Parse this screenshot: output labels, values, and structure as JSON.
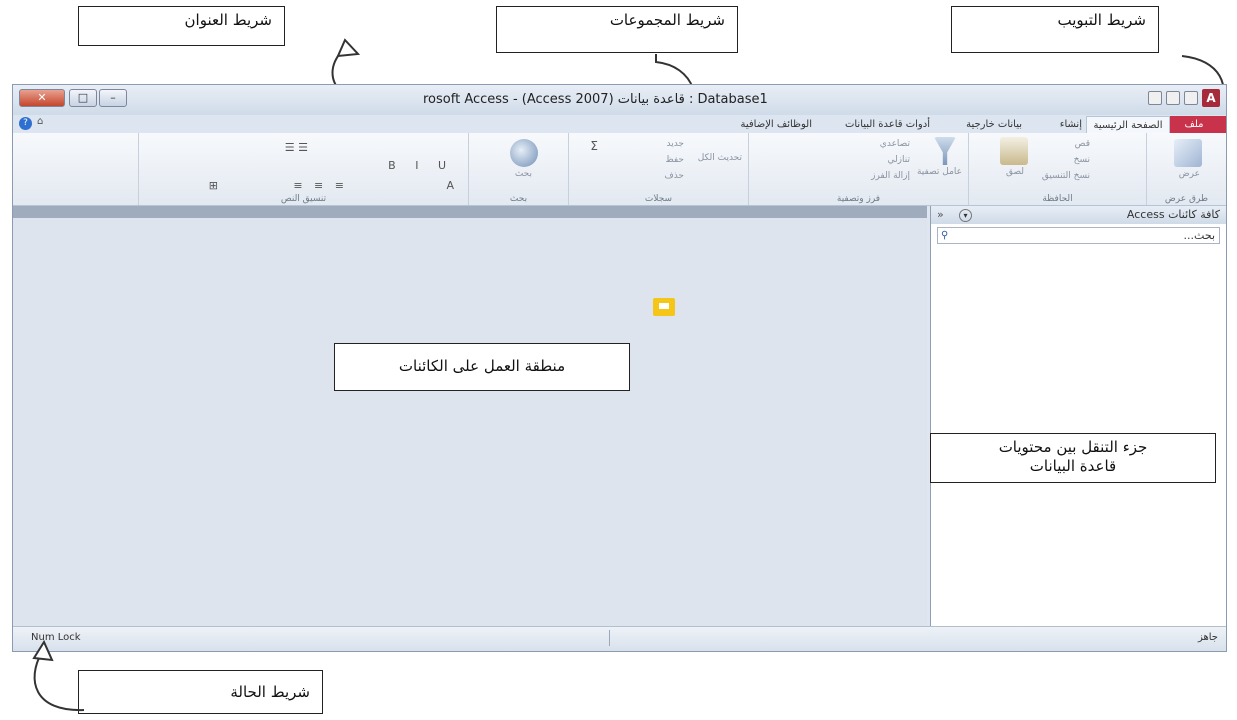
{
  "callouts": {
    "title_bar": "شريط العنوان",
    "groups_bar": "شريط المجموعات",
    "tabs_bar": "شريط التبويب",
    "object_workspace": "منطقة العمل على الكائنات",
    "nav_pane_line1": "جزء التنقل بين محتويات",
    "nav_pane_line2": "قاعدة البيانات",
    "status_bar": "شريط الحالة"
  },
  "window": {
    "title": "rosoft Access - (Access 2007) قاعدة بيانات : Database1",
    "logo_letter": "A",
    "tabs": [
      "ملف",
      "الصفحة الرئيسية",
      "إنشاء",
      "بيانات خارجية",
      "أدوات قاعدة البيانات",
      "الوظائف الإضافية"
    ]
  },
  "ribbon": {
    "groups": {
      "views": "طرق عرض",
      "clipboard": "الحافظة",
      "sort_filter": "فرز وتصفية",
      "records": "سجلات",
      "find": "بحث",
      "text_format": "تنسيق النص"
    },
    "buttons": {
      "view": "عرض",
      "paste": "لصق",
      "cut": "قص",
      "copy": "نسخ",
      "format_painter": "نسخ التنسيق",
      "filter": "عامل تصفية",
      "ascending": "تصاعدي",
      "descending": "تنازلي",
      "remove_sort": "إزالة الفرز",
      "new": "جديد",
      "save": "حفظ",
      "delete": "حذف",
      "refresh_all": "تحديث الكل",
      "find": "بحث"
    }
  },
  "nav_pane": {
    "header": "كافة كائنات Access",
    "collapse": "«",
    "search_placeholder": "بحث..."
  },
  "status": {
    "left": "Num Lock",
    "right": "جاهز"
  },
  "colors": {
    "file_tab": "#c8324a",
    "workspace_bg": "#dde4ee",
    "comment_icon": "#f5c518"
  }
}
